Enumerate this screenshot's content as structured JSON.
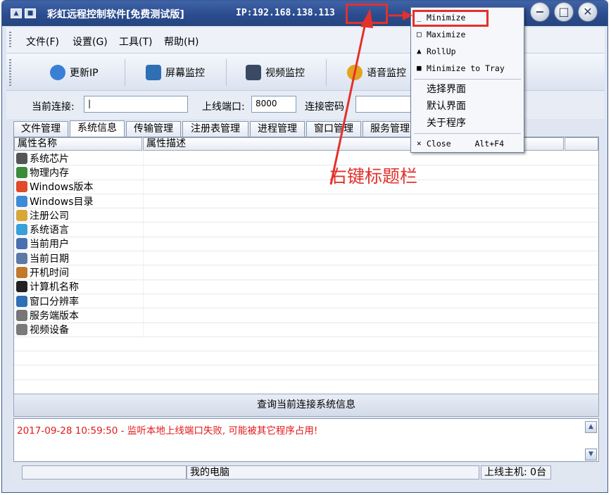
{
  "window": {
    "title": "彩虹远程控制软件[免费测试版]",
    "ip_label": "IP:192.168.138.113",
    "sys_btn_1": "▲",
    "sys_btn_2": "■",
    "controls": {
      "minimize": "−",
      "maximize": "□",
      "close": "✕"
    }
  },
  "menubar": [
    "文件(F)",
    "设置(G)",
    "工具(T)",
    "帮助(H)"
  ],
  "toolbar": [
    {
      "label": "更新IP",
      "icon": "globe-icon",
      "color": "#3b7fd4"
    },
    {
      "label": "屏幕监控",
      "icon": "monitor-icon",
      "color": "#2f6fb3"
    },
    {
      "label": "视频监控",
      "icon": "camera-icon",
      "color": "#3a4a63"
    },
    {
      "label": "语音监控",
      "icon": "audio-icon",
      "color": "#e6a21f"
    }
  ],
  "connection": {
    "current_label": "当前连接:",
    "current_value": "|",
    "port_label": "上线端口:",
    "port_value": "8000",
    "password_label": "连接密码",
    "password_value": ""
  },
  "tabs": [
    "文件管理",
    "系统信息",
    "传输管理",
    "注册表管理",
    "进程管理",
    "窗口管理",
    "服务管理"
  ],
  "active_tab": "系统信息",
  "columns": [
    "属性名称",
    "属性描述"
  ],
  "rows": [
    {
      "label": "系统芯片",
      "icon": "cpu-icon",
      "color": "#555555"
    },
    {
      "label": "物理内存",
      "icon": "memory-icon",
      "color": "#3b8c3b"
    },
    {
      "label": "Windows版本",
      "icon": "windows-logo-icon",
      "color": "#e04a2a"
    },
    {
      "label": "Windows目录",
      "icon": "folder-icon",
      "color": "#3d8ad6"
    },
    {
      "label": "注册公司",
      "icon": "lock-icon",
      "color": "#d7a73a"
    },
    {
      "label": "系统语言",
      "icon": "language-icon",
      "color": "#3aa0d8"
    },
    {
      "label": "当前用户",
      "icon": "user-icon",
      "color": "#4a6fb0"
    },
    {
      "label": "当前日期",
      "icon": "calendar-icon",
      "color": "#5c7aa6"
    },
    {
      "label": "开机时间",
      "icon": "boot-icon",
      "color": "#c07a2a"
    },
    {
      "label": "计算机名称",
      "icon": "computer-name-icon",
      "color": "#222222"
    },
    {
      "label": "窗口分辨率",
      "icon": "resolution-icon",
      "color": "#2f6fb3"
    },
    {
      "label": "服务端版本",
      "icon": "server-version-icon",
      "color": "#777777"
    },
    {
      "label": "视频设备",
      "icon": "webcam-icon",
      "color": "#7a7a7a"
    }
  ],
  "query_button": "查询当前连接系统信息",
  "log_message": "2017-09-28 10:59:50 - 监听本地上线端口失败, 可能被其它程序占用!",
  "scroll": {
    "up": "▲",
    "down": "▼"
  },
  "status": {
    "left": "",
    "center": "我的电脑",
    "right": "上线主机: 0台"
  },
  "context_menu": {
    "minimize": {
      "glyph": "_",
      "label": "Minimize"
    },
    "maximize": {
      "glyph": "□",
      "label": "Maximize"
    },
    "rollup": {
      "glyph": "▲",
      "label": "RollUp"
    },
    "tray": {
      "glyph": "■",
      "label": "Minimize to Tray"
    },
    "select_ui": "选择界面",
    "default_ui": "默认界面",
    "about": "关于程序",
    "close": {
      "glyph": "✕",
      "label": "Close",
      "shortcut": "Alt+F4"
    }
  },
  "annotation": "右键标题栏",
  "annotation_color": "#e3312c"
}
